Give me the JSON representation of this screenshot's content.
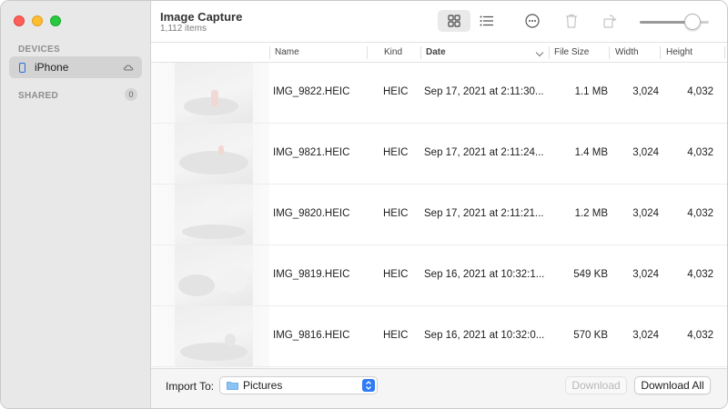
{
  "app": {
    "title": "Image Capture",
    "item_count": "1,112 items"
  },
  "sidebar": {
    "devices_label": "DEVICES",
    "device": {
      "name": "iPhone",
      "icon": "iphone-icon"
    },
    "shared_label": "SHARED",
    "shared_count": "0"
  },
  "toolbar": {
    "icons": [
      "grid-view-icon",
      "list-view-icon",
      "more-icon",
      "trash-icon",
      "rotate-icon"
    ],
    "thumbnail_size": 0.85
  },
  "columns": {
    "name": "Name",
    "kind": "Kind",
    "date": "Date",
    "file_size": "File Size",
    "width": "Width",
    "height": "Height"
  },
  "rows": [
    {
      "name": "IMG_9822.HEIC",
      "kind": "HEIC",
      "date": "Sep 17, 2021 at 2:11:30...",
      "size": "1.1 MB",
      "width": "3,024",
      "height": "4,032"
    },
    {
      "name": "IMG_9821.HEIC",
      "kind": "HEIC",
      "date": "Sep 17, 2021 at 2:11:24...",
      "size": "1.4 MB",
      "width": "3,024",
      "height": "4,032"
    },
    {
      "name": "IMG_9820.HEIC",
      "kind": "HEIC",
      "date": "Sep 17, 2021 at 2:11:21...",
      "size": "1.2 MB",
      "width": "3,024",
      "height": "4,032"
    },
    {
      "name": "IMG_9819.HEIC",
      "kind": "HEIC",
      "date": "Sep 16, 2021 at 10:32:1...",
      "size": "549 KB",
      "width": "3,024",
      "height": "4,032"
    },
    {
      "name": "IMG_9816.HEIC",
      "kind": "HEIC",
      "date": "Sep 16, 2021 at 10:32:0...",
      "size": "570 KB",
      "width": "3,024",
      "height": "4,032"
    }
  ],
  "footer": {
    "import_label": "Import To:",
    "import_destination": "Pictures",
    "download_label": "Download",
    "download_all_label": "Download All"
  },
  "colors": {
    "accent": "#2f7bf5",
    "close": "#ff5f57",
    "minimize": "#febc2e",
    "maximize": "#28c840"
  }
}
